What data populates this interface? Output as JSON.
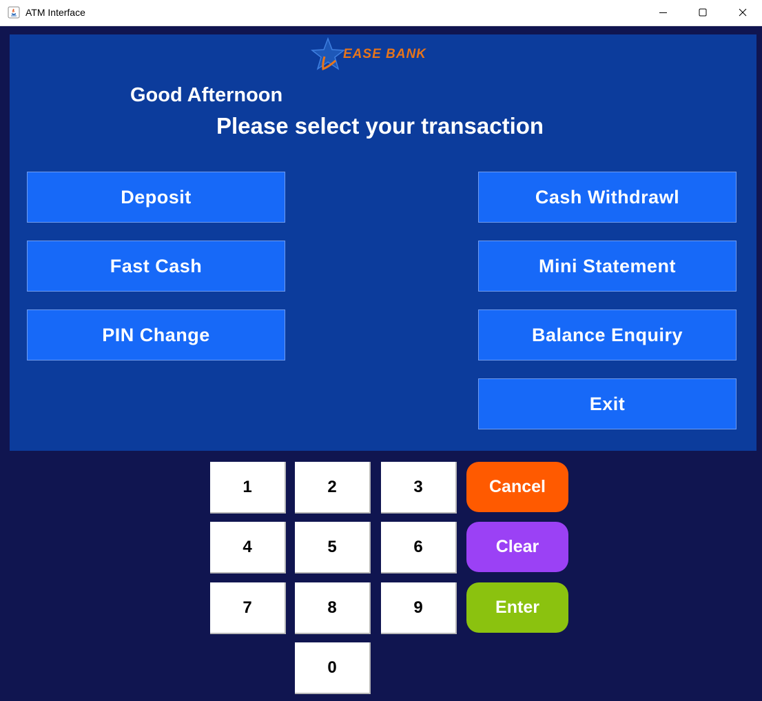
{
  "window": {
    "title": "ATM Interface"
  },
  "bank": {
    "logo_text": "EASE BANK"
  },
  "screen": {
    "greeting": "Good Afternoon",
    "prompt": "Please select your transaction"
  },
  "transactions": {
    "deposit": "Deposit",
    "fast_cash": "Fast Cash",
    "pin_change": "PIN Change",
    "cash_withdrawal": "Cash Withdrawl",
    "mini_statement": "Mini Statement",
    "balance_enquiry": "Balance Enquiry",
    "exit": "Exit"
  },
  "keypad": {
    "keys": [
      "1",
      "2",
      "3",
      "4",
      "5",
      "6",
      "7",
      "8",
      "9",
      "0"
    ],
    "cancel": "Cancel",
    "clear": "Clear",
    "enter": "Enter"
  },
  "colors": {
    "background": "#101550",
    "panel": "#0c3c9c",
    "transaction_button": "#1769f8",
    "cancel": "#ff5a00",
    "clear": "#9b41f5",
    "enter": "#8bc20f",
    "logo_accent": "#e8751a"
  }
}
